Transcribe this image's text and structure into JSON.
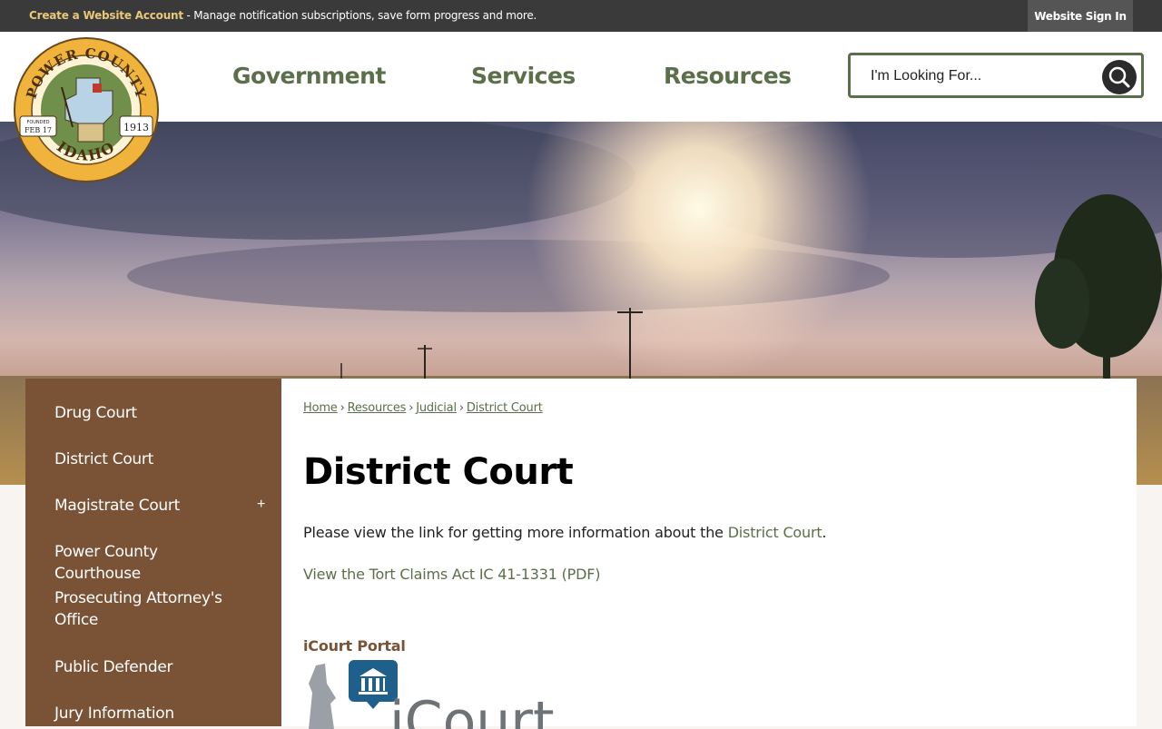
{
  "topbar": {
    "create_account": "Create a Website Account",
    "message": " - Manage notification subscriptions, save form progress and more.",
    "sign_in": "Website Sign In"
  },
  "logo": {
    "top_text": "POWER COUNTY",
    "bottom_text": "IDAHO",
    "founded_label": "FOUNDED",
    "founded_date": "FEB 17",
    "year": "1913"
  },
  "nav": {
    "items": [
      {
        "label": "Government"
      },
      {
        "label": "Services"
      },
      {
        "label": "Resources"
      }
    ]
  },
  "search": {
    "placeholder": "I'm Looking For..."
  },
  "sidebar": {
    "items": [
      {
        "label": "Drug Court"
      },
      {
        "label": "District Court"
      },
      {
        "label": "Magistrate Court",
        "expand_symbol": "+"
      },
      {
        "label": "Power County Courthouse"
      },
      {
        "label": "Prosecuting Attorney's Office"
      },
      {
        "label": "Public Defender"
      },
      {
        "label": "Jury Information"
      }
    ]
  },
  "breadcrumb": {
    "items": [
      "Home",
      "Resources",
      "Judicial",
      "District Court"
    ],
    "separator": "›"
  },
  "page": {
    "title": "District Court",
    "paragraph_prefix": "Please view the link for getting more information about the ",
    "paragraph_link": "District Court",
    "paragraph_suffix": ".",
    "tort_link": "View the Tort Claims Act IC 41-1331 (PDF)",
    "portal_heading": "iCourt Portal",
    "portal_logo_text": "iCourt"
  },
  "colors": {
    "accent_green": "#5b6f4a",
    "sidebar_brown": "#7a5236",
    "topbar_dark": "#3a3a3a",
    "account_gold": "#e8c97a"
  }
}
